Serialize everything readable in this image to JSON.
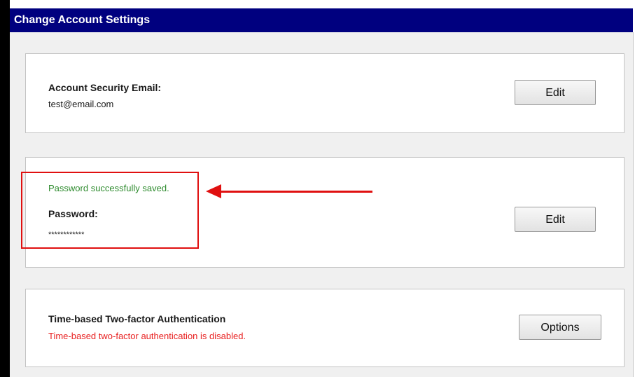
{
  "window": {
    "title": "Change Account Settings"
  },
  "email_section": {
    "label": "Account Security Email:",
    "value": "test@email.com",
    "button_label": "Edit"
  },
  "password_section": {
    "success_message": "Password successfully saved.",
    "label": "Password:",
    "masked_value": "************",
    "button_label": "Edit"
  },
  "twofactor_section": {
    "label": "Time-based Two-factor Authentication",
    "status_message": "Time-based two-factor authentication is disabled.",
    "button_label": "Options"
  },
  "colors": {
    "title_bar": "#00007f",
    "success": "#2e8b2e",
    "error": "#e82020",
    "annotation": "#e01010"
  }
}
